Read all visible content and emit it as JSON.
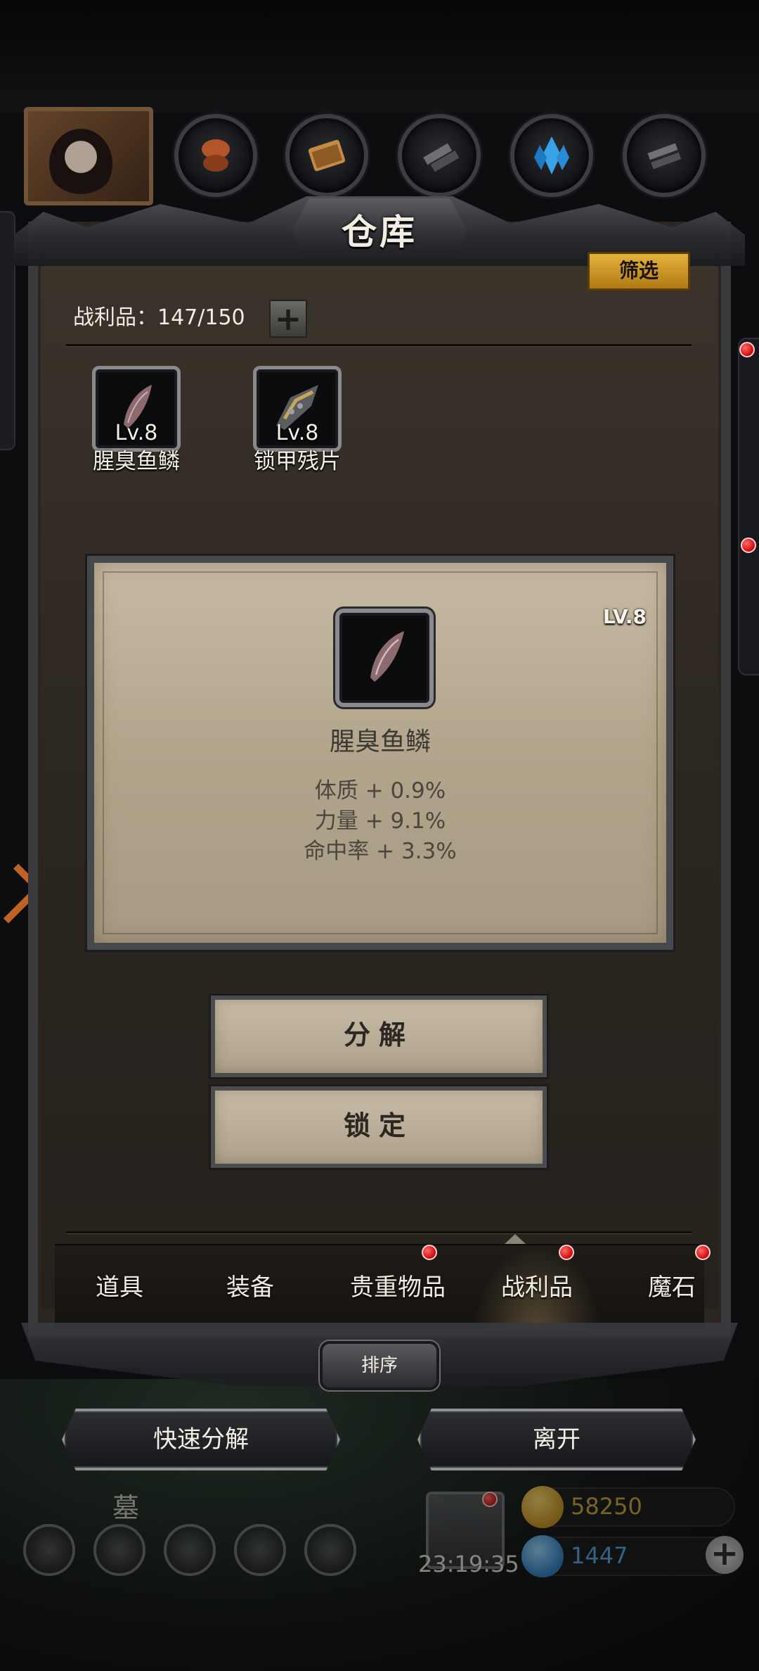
{
  "window": {
    "title": "仓库"
  },
  "filter_label": "筛选",
  "loot_count": "战利品：147/150",
  "plus_label": "+",
  "category_icons": [
    {
      "icon": "armor-icon"
    },
    {
      "icon": "scroll-icon"
    },
    {
      "icon": "material-icon"
    },
    {
      "icon": "crystal-icon"
    },
    {
      "icon": "misc-icon"
    }
  ],
  "items": [
    {
      "level": "Lv.8",
      "name": "腥臭鱼鳞",
      "icon": "fish-scale-icon"
    },
    {
      "level": "Lv.8",
      "name": "锁甲残片",
      "icon": "chainmail-shard-icon"
    }
  ],
  "detail": {
    "level": "LV.8",
    "name": "腥臭鱼鳞",
    "icon": "fish-scale-icon",
    "stats": [
      "体质 + 0.9%",
      "力量 + 9.1%",
      "命中率 + 3.3%"
    ]
  },
  "actions": {
    "decompose": "分解",
    "lock": "锁定"
  },
  "tabs": [
    {
      "label": "道具",
      "badge": false,
      "active": false
    },
    {
      "label": "装备",
      "badge": false,
      "active": false
    },
    {
      "label": "贵重物品",
      "badge": true,
      "active": false
    },
    {
      "label": "战利品",
      "badge": true,
      "active": true
    },
    {
      "label": "魔石",
      "badge": true,
      "active": false
    }
  ],
  "sort_label": "排序",
  "bottom_buttons": {
    "quick_decompose": "快速分解",
    "leave": "离开"
  },
  "hud": {
    "area_name": "墓园",
    "timer": "23:19:35",
    "gold": "58250",
    "gems": "1447"
  },
  "colors": {
    "accent_gold": "#e4b33a",
    "badge_red": "#d40f0f",
    "card_parchment": "#b2a58c",
    "panel_dark": "#2b2620"
  }
}
